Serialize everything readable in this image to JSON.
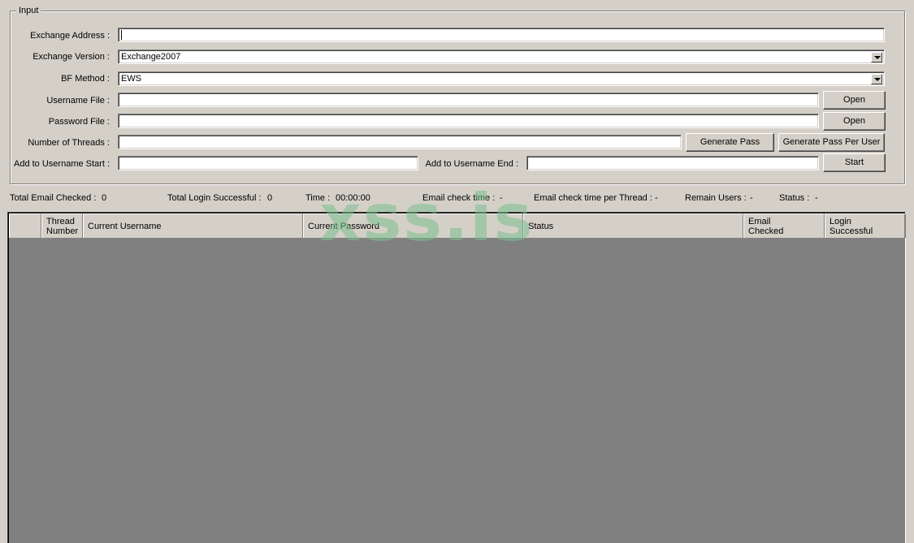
{
  "input_group": {
    "title": "Input",
    "exchange_address": {
      "label": "Exchange Address :",
      "value": ""
    },
    "exchange_version": {
      "label": "Exchange Version :",
      "value": "Exchange2007"
    },
    "bf_method": {
      "label": "BF Method :",
      "value": "EWS"
    },
    "username_file": {
      "label": "Username File :",
      "value": "",
      "button": "Open"
    },
    "password_file": {
      "label": "Password File :",
      "value": "",
      "button": "Open"
    },
    "threads": {
      "label": "Number of Threads :",
      "value": "",
      "generate_pass": "Generate Pass",
      "generate_pass_per_user": "Generate Pass Per User"
    },
    "username_start": {
      "label": "Add to Username Start :",
      "value": ""
    },
    "username_end": {
      "label": "Add to Username End :",
      "value": ""
    },
    "start_button": "Start"
  },
  "stats": {
    "total_email_checked_label": "Total Email Checked :",
    "total_email_checked": "0",
    "total_login_successful_label": "Total Login Successful :",
    "total_login_successful": "0",
    "time_label": "Time :",
    "time": "00:00:00",
    "email_check_time_label": "Email check time :",
    "email_check_time": "-",
    "email_check_time_per_thread_label": "Email check time per Thread :",
    "email_check_time_per_thread": "-",
    "remain_users_label": "Remain Users :",
    "remain_users": "-",
    "status_label": "Status :",
    "status": "-"
  },
  "table": {
    "columns": [
      "",
      "Thread\nNumber",
      "Current Username",
      "Current Password",
      "Status",
      "Email\nChecked",
      "Login\nSuccessful"
    ],
    "rows": []
  },
  "watermark": "xss.is",
  "colors": {
    "face": "#d4d0c8",
    "grid_bg": "#808080",
    "watermark": "#78be8c"
  }
}
